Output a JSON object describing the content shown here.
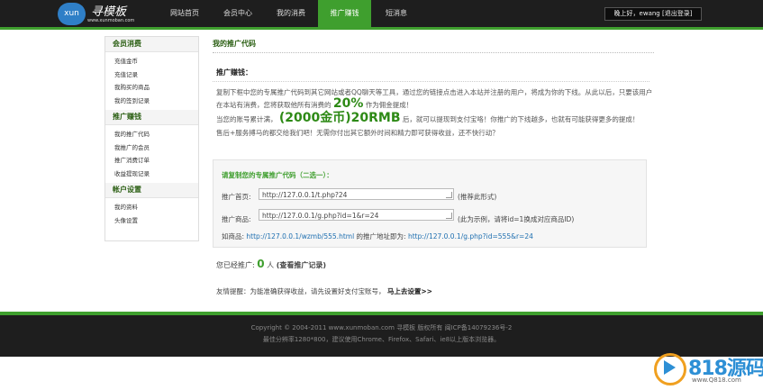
{
  "header": {
    "logo_badge": "xun",
    "logo_title": "寻模板",
    "logo_url": "www.xunmoban.com",
    "nav": [
      "网站首页",
      "会员中心",
      "我的消费",
      "推广赚钱",
      "短消息"
    ],
    "active_nav": "推广赚钱",
    "user_text": "晚上好，ewang [退出登录]"
  },
  "sidebar": {
    "sections": [
      {
        "title": "会员消费",
        "items": [
          "充值金币",
          "充值记录",
          "我购买的商品",
          "我的签到记录"
        ]
      },
      {
        "title": "推广赚钱",
        "items": [
          "我的推广代码",
          "我推广的会员",
          "推广消费订单",
          "收益提现记录"
        ]
      },
      {
        "title": "帐户设置",
        "items": [
          "我的资料",
          "头像设置"
        ]
      }
    ]
  },
  "main": {
    "title": "我的推广代码",
    "section_head": "推广赚钱：",
    "para1": "复制下框中您的专属推广代码到其它网站或者QQ聊天等工具，通过您的链接点击进入本站并注册的用户，将成为你的下线。从此以后，只要该用户在本站有消费，您将获取他所有消费的",
    "para1_pct": "20%",
    "para1_end": "作为佣金提成！",
    "para2_start": "当您的账号累计满，",
    "para2_big": "(2000金币)20RMB",
    "para2_end": "后，就可以提现到支付宝咯！你推广的下线越多，也就有可能获得更多的提成！",
    "para3": "售后+服务搏马的都交给我们吧！无需你付出其它额外时间和精力即可获得收益，还不快行动？"
  },
  "code": {
    "head": "请复制您的专属推广代码（二选一）：",
    "home_label": "推广首页:",
    "home_value": "http://127.0.0.1/t.php?24",
    "home_hint": "(推荐此形式)",
    "goods_label": "推广商品:",
    "goods_value": "http://127.0.0.1/g.php?id=1&r=24",
    "goods_hint": "(此为示例，请将id=1换成对应商品ID)",
    "ex_prefix": "如商品:",
    "ex_url1": "http://127.0.0.1/wzmb/555.html",
    "ex_mid": "的推广地址即为:",
    "ex_url2": "http://127.0.0.1/g.php?id=555&r=24"
  },
  "promoted": {
    "label": "您已经推广:",
    "count": "0",
    "unit": "人",
    "link": "(查看推广记录)"
  },
  "tip": {
    "text": "友情提醒：为能准确获得收益，请先设置好支付宝账号，",
    "link": "马上去设置>>"
  },
  "footer": {
    "line1": "Copyright © 2004-2011 www.xunmoban.com  寻模板  版权所有 闽ICP备14079236号-2",
    "line2": "最佳分辨率1280*800，建议使用Chrome、Firefox、Safari、ie8以上版本浏览器。"
  },
  "watermark": {
    "text": "818源码",
    "url": "www.Q818.com"
  },
  "colors": {
    "accent_green": "#3f9f2e",
    "header_bg": "#1e1e1e",
    "link_blue": "#1e6fb0"
  }
}
